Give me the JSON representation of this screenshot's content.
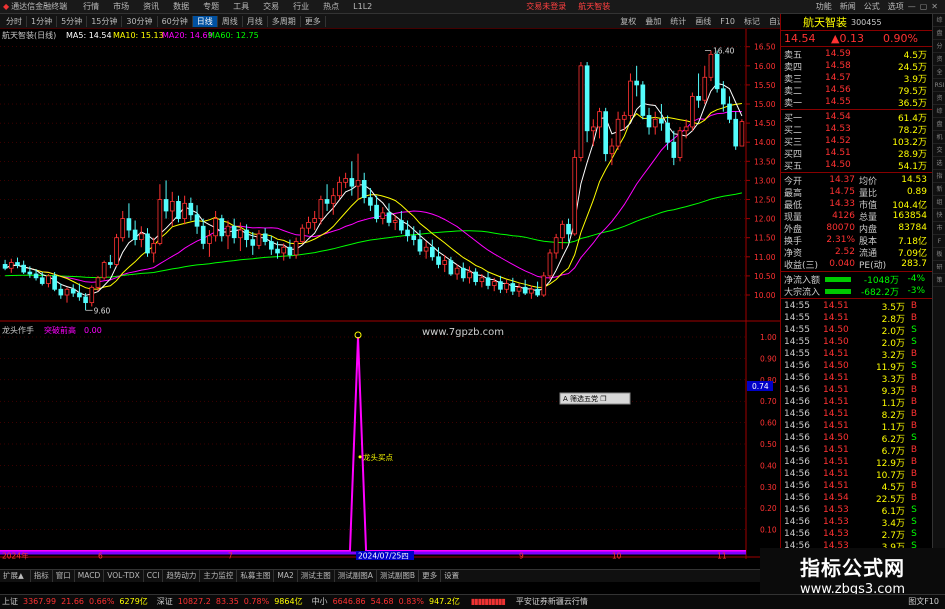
{
  "titlebar": {
    "app": "通达信金融终端",
    "menus": [
      "行情",
      "市场",
      "资讯",
      "数据",
      "专题",
      "工具",
      "交易",
      "行业",
      "热点",
      "L1L2"
    ],
    "trade_login": "交易未登录",
    "stock_tag": "航天智装",
    "right_links": [
      "功能",
      "新闻",
      "公式",
      "选项"
    ]
  },
  "menubar": {
    "periods": [
      "分时",
      "1分钟",
      "5分钟",
      "15分钟",
      "30分钟",
      "60分钟",
      "日线",
      "周线",
      "月线",
      "多周期",
      "更多"
    ],
    "active": "日线",
    "right": [
      "复权",
      "叠加",
      "统计",
      "画线",
      "F10",
      "标记",
      "自选"
    ]
  },
  "chart": {
    "info": {
      "name": "航天智装(日线)",
      "ma5": "MA5: 14.54",
      "ma10": "MA10: 15.13",
      "ma20": "MA20: 14.69",
      "ma60": "MA60: 12.75"
    },
    "y_labels": [
      "16.50",
      "16.00",
      "15.50",
      "15.00",
      "14.50",
      "14.00",
      "13.50",
      "13.00",
      "12.50",
      "12.00",
      "11.50",
      "11.00",
      "10.50",
      "10.00"
    ],
    "high_label": "16.40",
    "low_label": "9.60",
    "watermark": "www.7gpzb.com",
    "colors": {
      "up": "#ff3232",
      "down": "#54fcfc",
      "ma5": "#ffffff",
      "ma10": "#ffff00",
      "ma20": "#ff00ff",
      "ma60": "#00ff00",
      "grid": "#7a0000",
      "pane_border": "#a00000"
    },
    "candles": [
      [
        10.8,
        10.92,
        10.65,
        10.7
      ],
      [
        10.7,
        10.95,
        10.58,
        10.85
      ],
      [
        10.85,
        10.98,
        10.7,
        10.78
      ],
      [
        10.78,
        10.9,
        10.55,
        10.6
      ],
      [
        10.6,
        10.75,
        10.45,
        10.55
      ],
      [
        10.55,
        10.68,
        10.38,
        10.45
      ],
      [
        10.45,
        10.6,
        10.25,
        10.3
      ],
      [
        10.3,
        10.55,
        10.2,
        10.5
      ],
      [
        10.5,
        10.6,
        10.1,
        10.15
      ],
      [
        10.15,
        10.3,
        9.9,
        10.0
      ],
      [
        10.0,
        10.2,
        9.8,
        10.15
      ],
      [
        10.15,
        10.28,
        9.95,
        10.05
      ],
      [
        10.05,
        10.3,
        9.85,
        9.95
      ],
      [
        9.95,
        10.05,
        9.6,
        9.8
      ],
      [
        9.8,
        10.25,
        9.7,
        10.2
      ],
      [
        10.2,
        10.5,
        10.1,
        10.45
      ],
      [
        10.45,
        10.9,
        10.4,
        10.85
      ],
      [
        10.85,
        11.05,
        10.7,
        10.8
      ],
      [
        10.8,
        11.6,
        10.75,
        11.5
      ],
      [
        11.5,
        12.2,
        11.4,
        12.0
      ],
      [
        12.0,
        12.4,
        11.5,
        11.7
      ],
      [
        11.7,
        11.95,
        11.3,
        11.45
      ],
      [
        11.45,
        11.8,
        11.25,
        11.6
      ],
      [
        11.6,
        11.75,
        11.0,
        11.1
      ],
      [
        11.1,
        11.5,
        10.85,
        11.35
      ],
      [
        11.35,
        12.9,
        11.3,
        12.5
      ],
      [
        12.5,
        13.0,
        12.0,
        12.2
      ],
      [
        12.2,
        12.7,
        11.8,
        12.45
      ],
      [
        12.45,
        12.6,
        11.9,
        12.0
      ],
      [
        12.0,
        12.6,
        11.85,
        12.4
      ],
      [
        12.4,
        12.55,
        11.95,
        12.1
      ],
      [
        12.1,
        12.35,
        11.6,
        11.8
      ],
      [
        11.8,
        12.0,
        11.2,
        11.35
      ],
      [
        11.35,
        11.7,
        11.0,
        11.55
      ],
      [
        11.55,
        12.2,
        11.4,
        12.0
      ],
      [
        12.0,
        12.1,
        11.4,
        11.55
      ],
      [
        11.55,
        11.95,
        11.2,
        11.8
      ],
      [
        11.8,
        12.0,
        11.35,
        11.5
      ],
      [
        11.5,
        11.9,
        11.15,
        11.7
      ],
      [
        11.7,
        11.85,
        11.25,
        11.45
      ],
      [
        11.45,
        11.65,
        11.05,
        11.3
      ],
      [
        11.3,
        11.7,
        11.2,
        11.6
      ],
      [
        11.6,
        11.75,
        11.3,
        11.4
      ],
      [
        11.4,
        11.55,
        11.05,
        11.2
      ],
      [
        11.2,
        11.4,
        10.95,
        11.1
      ],
      [
        11.1,
        11.35,
        10.9,
        11.25
      ],
      [
        11.25,
        11.45,
        10.95,
        11.05
      ],
      [
        11.05,
        11.5,
        10.95,
        11.4
      ],
      [
        11.4,
        11.85,
        11.35,
        11.75
      ],
      [
        11.75,
        12.05,
        11.6,
        11.9
      ],
      [
        11.9,
        12.2,
        11.7,
        12.0
      ],
      [
        12.0,
        12.6,
        11.85,
        12.5
      ],
      [
        12.5,
        12.9,
        12.2,
        12.4
      ],
      [
        12.4,
        12.8,
        12.1,
        12.6
      ],
      [
        12.6,
        13.1,
        12.5,
        12.95
      ],
      [
        12.95,
        13.2,
        12.8,
        13.05
      ],
      [
        13.05,
        13.5,
        12.6,
        12.85
      ],
      [
        12.85,
        13.7,
        12.5,
        13.0
      ],
      [
        13.0,
        13.2,
        12.4,
        12.55
      ],
      [
        12.55,
        12.8,
        12.2,
        12.35
      ],
      [
        12.35,
        12.6,
        11.9,
        12.0
      ],
      [
        12.0,
        12.3,
        11.85,
        12.15
      ],
      [
        12.15,
        12.4,
        11.8,
        11.9
      ],
      [
        11.9,
        12.1,
        11.7,
        11.95
      ],
      [
        11.95,
        12.2,
        11.6,
        11.7
      ],
      [
        11.7,
        11.95,
        11.4,
        11.55
      ],
      [
        11.55,
        11.8,
        11.3,
        11.45
      ],
      [
        11.45,
        11.7,
        11.05,
        11.15
      ],
      [
        11.15,
        11.4,
        10.95,
        11.25
      ],
      [
        11.25,
        11.45,
        10.9,
        11.0
      ],
      [
        11.0,
        11.25,
        10.7,
        10.8
      ],
      [
        10.8,
        11.05,
        10.6,
        10.9
      ],
      [
        10.9,
        11.0,
        10.5,
        10.55
      ],
      [
        10.55,
        10.8,
        10.4,
        10.7
      ],
      [
        10.7,
        10.85,
        10.35,
        10.45
      ],
      [
        10.45,
        10.75,
        10.3,
        10.6
      ],
      [
        10.6,
        10.7,
        10.25,
        10.35
      ],
      [
        10.35,
        10.55,
        10.2,
        10.45
      ],
      [
        10.45,
        10.6,
        10.15,
        10.25
      ],
      [
        10.25,
        10.45,
        10.1,
        10.35
      ],
      [
        10.35,
        10.5,
        10.05,
        10.15
      ],
      [
        10.15,
        10.4,
        10.05,
        10.3
      ],
      [
        10.3,
        10.45,
        10.0,
        10.1
      ],
      [
        10.1,
        10.3,
        9.95,
        10.2
      ],
      [
        10.2,
        10.4,
        10.0,
        10.05
      ],
      [
        10.05,
        10.25,
        9.9,
        10.15
      ],
      [
        10.15,
        10.35,
        9.95,
        10.0
      ],
      [
        10.0,
        10.6,
        9.95,
        10.5
      ],
      [
        10.5,
        11.2,
        10.4,
        11.1
      ],
      [
        11.1,
        11.6,
        10.95,
        11.5
      ],
      [
        11.5,
        11.95,
        11.2,
        11.85
      ],
      [
        11.85,
        12.0,
        11.4,
        11.6
      ],
      [
        11.6,
        13.8,
        11.55,
        13.6
      ],
      [
        13.6,
        16.1,
        13.5,
        16.0
      ],
      [
        16.0,
        16.1,
        14.0,
        14.3
      ],
      [
        14.3,
        14.6,
        13.9,
        14.4
      ],
      [
        14.4,
        14.9,
        14.1,
        14.8
      ],
      [
        14.8,
        14.9,
        13.5,
        13.7
      ],
      [
        13.7,
        14.1,
        13.4,
        13.9
      ],
      [
        13.9,
        14.8,
        13.8,
        14.6
      ],
      [
        14.6,
        14.8,
        14.3,
        14.7
      ],
      [
        14.7,
        15.8,
        14.6,
        15.6
      ],
      [
        15.6,
        16.0,
        15.2,
        15.5
      ],
      [
        15.5,
        15.6,
        14.6,
        14.7
      ],
      [
        14.7,
        14.9,
        14.2,
        14.4
      ],
      [
        14.4,
        14.8,
        14.2,
        14.6
      ],
      [
        14.6,
        15.0,
        14.3,
        14.5
      ],
      [
        14.5,
        14.7,
        13.8,
        14.0
      ],
      [
        14.0,
        14.3,
        13.4,
        13.6
      ],
      [
        13.6,
        14.4,
        13.5,
        14.3
      ],
      [
        14.3,
        14.6,
        14.1,
        14.4
      ],
      [
        14.4,
        15.3,
        14.3,
        15.2
      ],
      [
        15.2,
        15.8,
        14.9,
        15.1
      ],
      [
        15.1,
        16.0,
        15.0,
        15.7
      ],
      [
        15.7,
        16.4,
        15.6,
        16.3
      ],
      [
        16.3,
        16.4,
        15.3,
        15.4
      ],
      [
        15.4,
        15.6,
        14.8,
        15.0
      ],
      [
        15.0,
        15.2,
        14.5,
        14.6
      ],
      [
        14.6,
        14.8,
        13.8,
        13.9
      ],
      [
        13.9,
        14.6,
        13.9,
        14.54
      ]
    ],
    "x_labels": [
      "2024年",
      "6",
      "7",
      "2024/07/25四",
      "9",
      "10",
      "11"
    ],
    "x_label_positions": [
      0,
      15,
      36,
      57,
      83,
      98,
      115
    ],
    "highlight_date": "2024/07/25四"
  },
  "indicator": {
    "title": "龙头作手",
    "sub": "突破前高",
    "val": "0.00",
    "annotation": "龙头买点",
    "y_labels": [
      "1.00",
      "0.90",
      "0.80",
      "0.70",
      "0.60",
      "0.50",
      "0.40",
      "0.30",
      "0.20",
      "0.10",
      "0.00"
    ],
    "cursor_value": "0.74",
    "popup": "A 筛选五党 ❐",
    "spike_index": 57
  },
  "tabs": [
    "指标",
    "窗口",
    "MACD",
    "VOL-TDX",
    "CCI",
    "趋势动力",
    "主力监控",
    "私募主图",
    "MA2",
    "测试主图",
    "测试副图A",
    "测试副图B",
    "更多",
    "设置"
  ],
  "tabs_left": "扩展▲",
  "tabs_right": "模板",
  "quote": {
    "name": "航天智装",
    "code": "300455",
    "price": "14.54",
    "change": "▲0.13",
    "pct": "0.90%",
    "asks": [
      {
        "l": "卖五",
        "p": "14.59",
        "v": "4.5万"
      },
      {
        "l": "卖四",
        "p": "14.58",
        "v": "24.5万"
      },
      {
        "l": "卖三",
        "p": "14.57",
        "v": "3.9万"
      },
      {
        "l": "卖二",
        "p": "14.56",
        "v": "79.5万"
      },
      {
        "l": "卖一",
        "p": "14.55",
        "v": "36.5万"
      }
    ],
    "bids": [
      {
        "l": "买一",
        "p": "14.54",
        "v": "61.4万"
      },
      {
        "l": "买二",
        "p": "14.53",
        "v": "78.2万"
      },
      {
        "l": "买三",
        "p": "14.52",
        "v": "103.2万"
      },
      {
        "l": "买四",
        "p": "14.51",
        "v": "28.9万"
      },
      {
        "l": "买五",
        "p": "14.50",
        "v": "54.1万"
      }
    ],
    "stats": [
      [
        "今开",
        "14.37",
        "均价",
        "14.53"
      ],
      [
        "最高",
        "14.75",
        "量比",
        "0.89"
      ],
      [
        "最低",
        "14.33",
        "市值",
        "104.4亿"
      ],
      [
        "现量",
        "4126",
        "总量",
        "163854"
      ],
      [
        "外盘",
        "80070",
        "内盘",
        "83784"
      ],
      [
        "换手",
        "2.31%",
        "股本",
        "7.18亿"
      ],
      [
        "净资",
        "2.52",
        "流通",
        "7.09亿"
      ],
      [
        "收益(三)",
        "0.040",
        "PE(动)",
        "283.7"
      ]
    ],
    "flow": [
      {
        "l": "净流入额",
        "v": "-1048万",
        "p": "-4%"
      },
      {
        "l": "大宗流入",
        "v": "-682.2万",
        "p": "-3%"
      }
    ],
    "ticks": [
      [
        "14:55",
        "14.51",
        "3.5万",
        "B"
      ],
      [
        "14:55",
        "14.51",
        "2.8万",
        "B"
      ],
      [
        "14:55",
        "14.50",
        "2.0万",
        "S"
      ],
      [
        "14:55",
        "14.50",
        "2.0万",
        "S"
      ],
      [
        "14:55",
        "14.51",
        "3.2万",
        "B"
      ],
      [
        "14:56",
        "14.50",
        "11.9万",
        "S"
      ],
      [
        "14:56",
        "14.51",
        "3.3万",
        "B"
      ],
      [
        "14:56",
        "14.51",
        "9.3万",
        "B"
      ],
      [
        "14:56",
        "14.51",
        "1.1万",
        "B"
      ],
      [
        "14:56",
        "14.51",
        "8.2万",
        "B"
      ],
      [
        "14:56",
        "14.51",
        "1.1万",
        "B"
      ],
      [
        "14:56",
        "14.50",
        "6.2万",
        "S"
      ],
      [
        "14:56",
        "14.51",
        "6.7万",
        "B"
      ],
      [
        "14:56",
        "14.51",
        "12.9万",
        "B"
      ],
      [
        "14:56",
        "14.51",
        "10.7万",
        "B"
      ],
      [
        "14:56",
        "14.51",
        "4.5万",
        "B"
      ],
      [
        "14:56",
        "14.54",
        "22.5万",
        "B"
      ],
      [
        "14:56",
        "14.53",
        "6.1万",
        "S"
      ],
      [
        "14:56",
        "14.53",
        "3.4万",
        "S"
      ],
      [
        "14:56",
        "14.53",
        "2.7万",
        "S"
      ],
      [
        "14:56",
        "14.53",
        "3.9万",
        "S"
      ],
      [
        "14:56",
        "14.54",
        "121.0万",
        "B"
      ]
    ]
  },
  "sidebar": [
    "综",
    "盘",
    "分",
    "资",
    "全",
    "RSI",
    "资",
    "综",
    "盘",
    "机",
    "交",
    "选",
    "指",
    "新",
    "组",
    "快",
    "市",
    "F",
    "板",
    "研",
    "策"
  ],
  "status": {
    "sh_name": "上证",
    "sh_val": "3367.99",
    "sh_chg": "21.66",
    "sh_pct": "0.66%",
    "sh_amt": "6279亿",
    "sz_name": "深证",
    "sz_val": "10827.2",
    "sz_chg": "83.35",
    "sz_pct": "0.78%",
    "sz_amt": "9864亿",
    "zx_name": "中小",
    "zx_val": "6646.86",
    "zx_chg": "54.68",
    "zx_pct": "0.83%",
    "zx_amt": "947.2亿",
    "broker": "平安证券新疆云行情",
    "btn": "图文F10"
  },
  "watermark2": {
    "title": "指标公式网",
    "url": "www.zbgs3.com"
  }
}
